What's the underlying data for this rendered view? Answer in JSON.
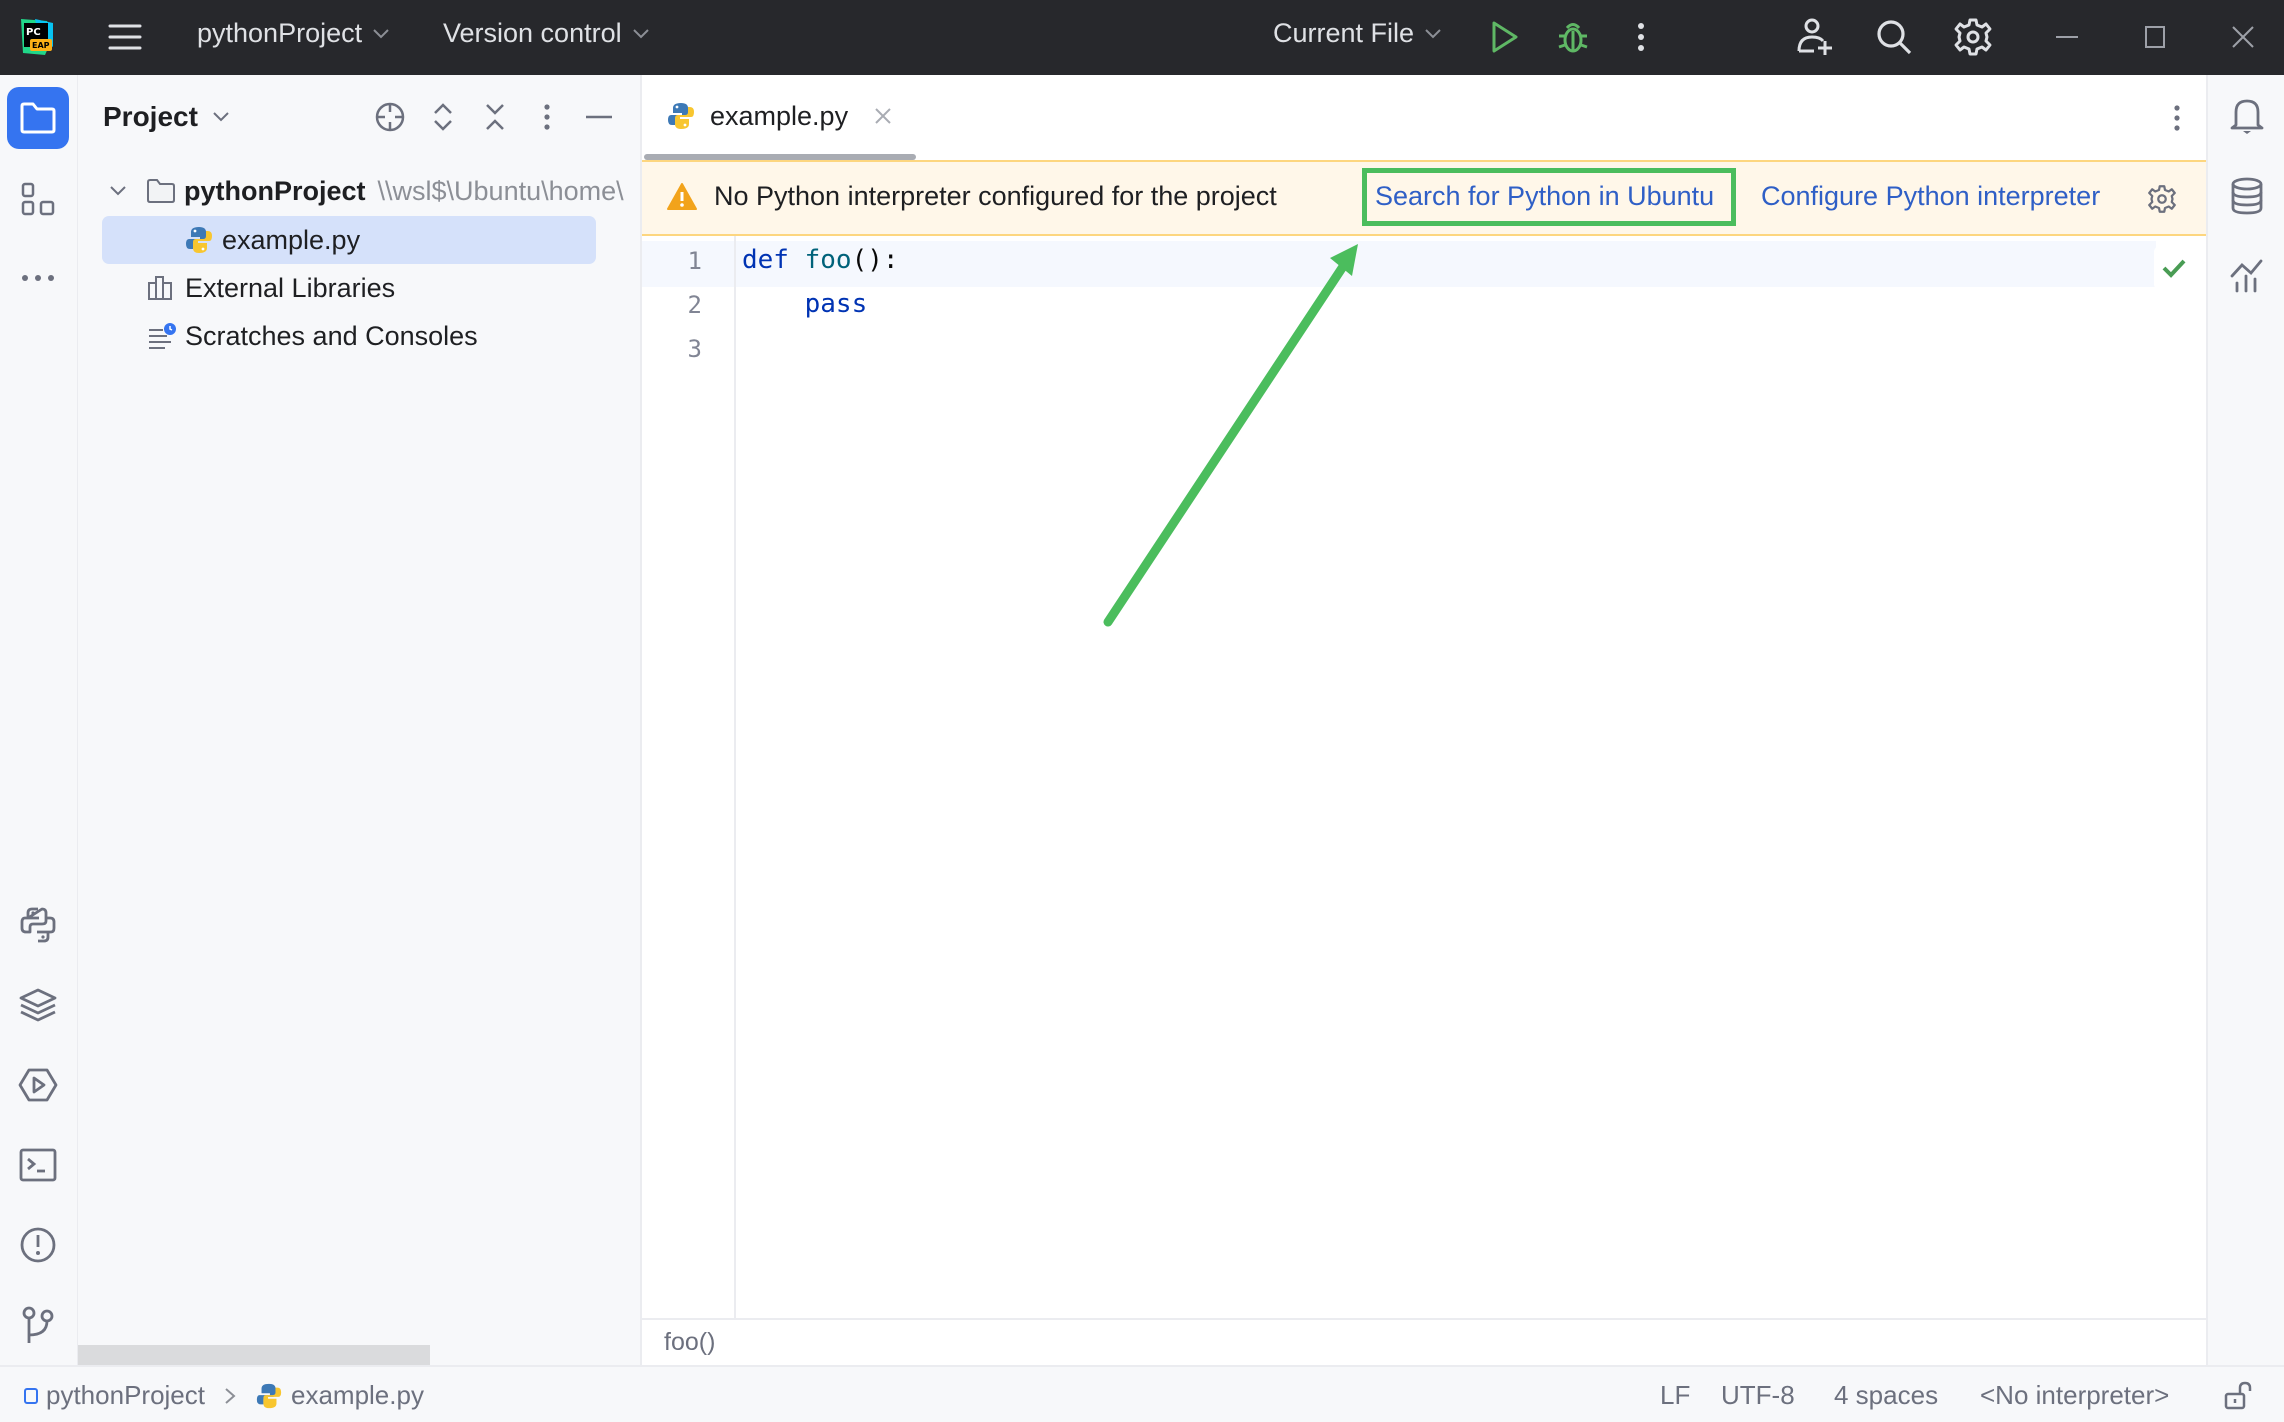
{
  "titlebar": {
    "app_logo": "pycharm-eap-logo",
    "project_name": "pythonProject",
    "vcs_label": "Version control",
    "run_config": "Current File",
    "icons": [
      "main-menu-icon",
      "run-icon",
      "debug-icon",
      "more-icon",
      "add-user-icon",
      "search-icon",
      "settings-icon",
      "minimize-icon",
      "maximize-icon",
      "close-icon"
    ]
  },
  "left_strip": {
    "top_items": [
      "project-icon",
      "structure-icon",
      "more-tools-icon"
    ],
    "bottom_items": [
      "python-console-icon",
      "layers-icon",
      "services-icon",
      "terminal-icon",
      "problems-icon",
      "git-icon"
    ]
  },
  "project_panel": {
    "title": "Project",
    "toolbar_icons": [
      "locate-icon",
      "expand-all-icon",
      "collapse-all-icon",
      "options-icon",
      "hide-icon"
    ],
    "tree": {
      "root": {
        "name": "pythonProject",
        "path": "\\\\wsl$\\Ubuntu\\home\\"
      },
      "items": [
        {
          "name": "example.py",
          "icon": "python-file-icon",
          "selected": true
        },
        {
          "name": "External Libraries",
          "icon": "library-icon"
        },
        {
          "name": "Scratches and Consoles",
          "icon": "scratches-icon"
        }
      ]
    }
  },
  "editor": {
    "tab": {
      "label": "example.py",
      "icon": "python-file-icon"
    },
    "banner": {
      "message": "No Python interpreter configured for the project",
      "link_search": "Search for Python in Ubuntu",
      "link_configure": "Configure Python interpreter"
    },
    "lines": [
      {
        "number": "1",
        "tokens": [
          {
            "t": "def",
            "c": "kw"
          },
          {
            "t": " "
          },
          {
            "t": "foo",
            "c": "fn"
          },
          {
            "t": "():",
            "c": "punc"
          }
        ]
      },
      {
        "number": "2",
        "tokens": [
          {
            "t": "    "
          },
          {
            "t": "pass",
            "c": "kw"
          }
        ]
      },
      {
        "number": "3",
        "tokens": []
      }
    ],
    "code_breadcrumb": "foo()",
    "inspection_status": "no-problems"
  },
  "right_strip": {
    "items": [
      "notifications-icon",
      "database-icon",
      "profiler-icon"
    ]
  },
  "status_bar": {
    "breadcrumb_project": "pythonProject",
    "breadcrumb_file": "example.py",
    "line_separator": "LF",
    "encoding": "UTF-8",
    "indent": "4 spaces",
    "interpreter": "<No interpreter>"
  },
  "colors": {
    "accent": "#3574f0",
    "link": "#2f5fc6",
    "annotation_green": "#4bbd5d",
    "banner_bg": "#fff7e9",
    "titlebar_bg": "#27282c"
  }
}
